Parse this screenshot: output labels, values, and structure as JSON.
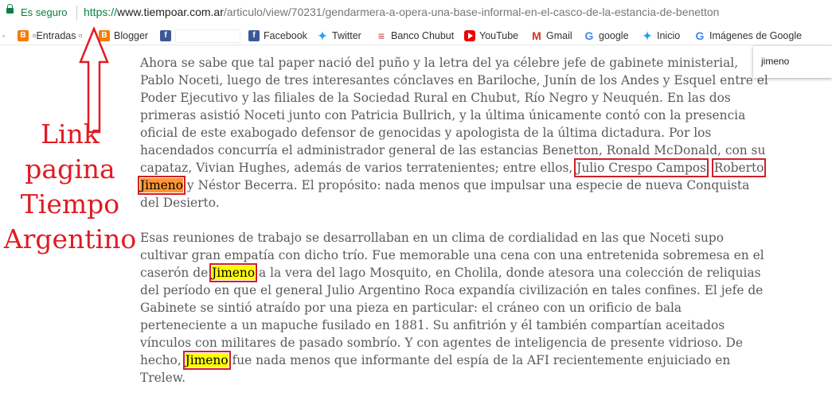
{
  "address_bar": {
    "secure_label": "Es seguro",
    "url_scheme": "https://",
    "url_host": "www.tiempoar.com.ar",
    "url_path": "/articulo/view/70231/gendarmera-a-opera-una-base-informal-en-el-casco-de-la-estancia-de-benetton"
  },
  "bookmarks": [
    {
      "label": "Entradas",
      "icon": "blogger-icon"
    },
    {
      "label": "Blogger",
      "icon": "blogger-icon"
    },
    {
      "label": "",
      "icon": "facebook-icon"
    },
    {
      "label": "Facebook",
      "icon": "facebook-icon"
    },
    {
      "label": "Twitter",
      "icon": "twitter-icon"
    },
    {
      "label": "Banco Chubut",
      "icon": "banco-chubut-icon"
    },
    {
      "label": "YouTube",
      "icon": "youtube-icon"
    },
    {
      "label": "Gmail",
      "icon": "gmail-icon"
    },
    {
      "label": "google",
      "icon": "google-icon"
    },
    {
      "label": "Inicio",
      "icon": "twitter-icon"
    },
    {
      "label": "Imágenes de Google",
      "icon": "google-icon"
    }
  ],
  "find_bar": {
    "query": "jimeno"
  },
  "article": {
    "p1": {
      "t1": "Ahora se sabe que tal paper nació del puño y la letra del ya célebre jefe de gabinete ministerial, Pablo Noceti, luego de tres interesantes cónclaves en Bariloche, Junín de los Andes y Esquel entre el Poder Ejecutivo y las filiales de la Sociedad Rural en Chubut, Río Negro y Neuquén. En las dos primeras asistió Noceti junto con Patricia Bullrich, y la última únicamente contó con la presencia oficial de este exabogado defensor de genocidas y apologista de la última dictadura. Por los hacendados concurría el administrador general de las estancias Benetton, Ronald McDonald, con su capataz, Vivian Hughes, además de varios terratenientes; entre ellos,",
      "name1": "Julio Crespo Campos",
      "t2": ",",
      "name2a": "Roberto",
      "name2b": "Jimeno",
      "t3": "y Néstor Becerra. El propósito: nada menos que impulsar una especie de nueva Conquista del Desierto."
    },
    "p2": {
      "t1": "Esas reuniones de trabajo se desarrollaban en un clima de cordialidad en las que Noceti supo cultivar gran empatía con dicho trío. Fue memorable una cena con una entretenida sobremesa en el caserón de",
      "match1": "Jimeno",
      "t2": "a la vera del lago Mosquito, en Cholila, donde atesora una colección de reliquias del período en que el general Julio Argentino Roca expandía civilización en tales confines. El jefe de Gabinete se sintió atraído por una pieza en particular: el cráneo con un orificio de bala perteneciente a un mapuche fusilado en 1881. Su anfitrión y él también compartían aceitados vínculos con militares de pasado sombrío. Y con agentes de inteligencia de presente vidrioso. De hecho,",
      "match2": "Jimeno",
      "t3": "fue nada menos que informante del espía de la AFI recientemente enjuiciado en Trelew."
    }
  },
  "annotation": {
    "lines": [
      "Link",
      "pagina",
      "Tiempo",
      "Argentino"
    ],
    "color": "#e01b24"
  }
}
